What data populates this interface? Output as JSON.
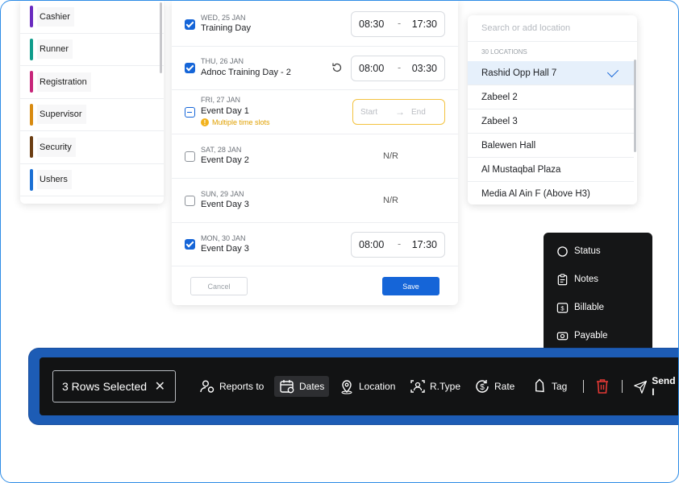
{
  "roles": [
    {
      "label": "Cashier",
      "color": "#6a2bbf"
    },
    {
      "label": "Runner",
      "color": "#0f9c8b"
    },
    {
      "label": "Registration",
      "color": "#c7267a"
    },
    {
      "label": "Supervisor",
      "color": "#d88a10"
    },
    {
      "label": "Security",
      "color": "#6b3d12"
    },
    {
      "label": "Ushers",
      "color": "#1a6fd4"
    }
  ],
  "dates": [
    {
      "day": "WED, 25 JAN",
      "name": "Training Day",
      "state": "checked",
      "start": "08:30",
      "end": "17:30"
    },
    {
      "day": "THU, 26 JAN",
      "name": "Adnoc Training Day - 2",
      "state": "checked",
      "start": "08:00",
      "end": "03:30"
    },
    {
      "day": "FRI, 27 JAN",
      "name": "Event Day 1",
      "state": "partial",
      "start_placeholder": "Start",
      "end_placeholder": "End",
      "warning": "Multiple time slots"
    },
    {
      "day": "SAT, 28 JAN",
      "name": "Event Day 2",
      "state": "empty",
      "value": "N/R"
    },
    {
      "day": "SUN, 29 JAN",
      "name": "Event Day 3",
      "state": "empty",
      "value": "N/R"
    },
    {
      "day": "MON, 30 JAN",
      "name": "Event Day 3",
      "state": "checked",
      "start": "08:00",
      "end": "17:30"
    }
  ],
  "time_separator": "-",
  "dates_actions": {
    "cancel": "Cancel",
    "save": "Save"
  },
  "locations": {
    "search_placeholder": "Search or add location",
    "count_label": "30 LOCATIONS",
    "items": [
      "Rashid Opp Hall 7",
      "Zabeel 2",
      "Zabeel 3",
      "Balewen Hall",
      "Al Mustaqbal Plaza",
      "Media Al Ain F (Above H3)"
    ],
    "selected_index": 0
  },
  "menu": {
    "items": [
      {
        "label": "Status",
        "icon": "circle-icon"
      },
      {
        "label": "Notes",
        "icon": "clipboard-icon"
      },
      {
        "label": "Billable",
        "icon": "billable-icon"
      },
      {
        "label": "Payable",
        "icon": "payable-icon"
      }
    ]
  },
  "action_bar": {
    "selection": "3 Rows Selected",
    "close": "✕",
    "actions": [
      {
        "label": "Reports to",
        "icon": "reports-to-icon"
      },
      {
        "label": "Dates",
        "icon": "calendar-icon",
        "active": true
      },
      {
        "label": "Location",
        "icon": "location-icon"
      },
      {
        "label": "R.Type",
        "icon": "rtype-icon"
      },
      {
        "label": "Rate",
        "icon": "rate-icon"
      },
      {
        "label": "Tag",
        "icon": "tag-icon"
      },
      {
        "label": "Send I",
        "icon": "send-icon"
      }
    ],
    "separator": "|"
  },
  "colors": {
    "accent": "#1565d8",
    "warning": "#f2b21c",
    "danger": "#e53935",
    "bar_outer": "#1d5cb5",
    "bar_inner": "#121314"
  }
}
